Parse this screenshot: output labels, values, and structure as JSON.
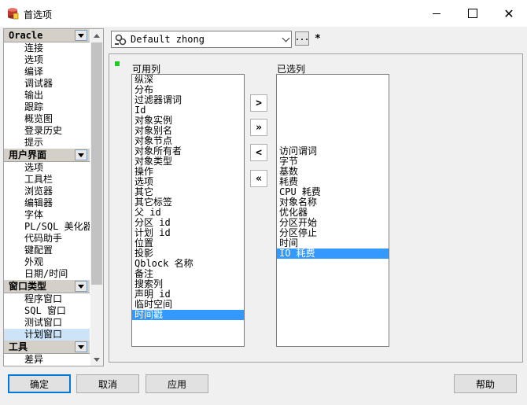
{
  "window": {
    "title": "首选项",
    "minimize": "—",
    "close": "✕"
  },
  "sidebar": {
    "categories": [
      {
        "label": "Oracle",
        "items": [
          "连接",
          "选项",
          "编译",
          "调试器",
          "输出",
          "跟踪",
          "概览图",
          "登录历史",
          "提示"
        ]
      },
      {
        "label": "用户界面",
        "items": [
          "选项",
          "工具栏",
          "浏览器",
          "编辑器",
          "字体",
          "PL/SQL 美化器",
          "代码助手",
          "键配置",
          "外观",
          "日期/时间"
        ]
      },
      {
        "label": "窗口类型",
        "items": [
          "程序窗口",
          "SQL 窗口",
          "测试窗口",
          "计划窗口"
        ]
      },
      {
        "label": "工具",
        "items": [
          "差异"
        ]
      }
    ],
    "selected": "计划窗口"
  },
  "toolbar": {
    "profile": "Default zhong",
    "more_label": "...",
    "modified_mark": "*"
  },
  "available": {
    "label": "可用列",
    "items": [
      "纵深",
      "分布",
      "过滤器谓词",
      "Id",
      "对象实例",
      "对象别名",
      "对象节点",
      "对象所有者",
      "对象类型",
      "操作",
      "选项",
      "其它",
      "其它标签",
      "父 id",
      "分区 id",
      "计划 id",
      "位置",
      "投影",
      "Qblock 名称",
      "备注",
      "搜索列",
      "声明 id",
      "临时空间",
      "时间戳"
    ],
    "selected": "时间戳"
  },
  "selected_cols": {
    "label": "已选列",
    "items": [
      "访问谓词",
      "字节",
      "基数",
      "耗费",
      "CPU 耗费",
      "对象名称",
      "优化器",
      "分区开始",
      "分区停止",
      "时间",
      "IO 耗费"
    ],
    "selected": "IO 耗费"
  },
  "move_buttons": {
    "add": ">",
    "add_all": "»",
    "remove": "<",
    "remove_all": "«"
  },
  "buttons": {
    "ok": "确定",
    "cancel": "取消",
    "apply": "应用",
    "help": "帮助"
  },
  "colors": {
    "selection": "#3399ff",
    "indicator": "#22cc22",
    "focus": "#0078d7"
  }
}
